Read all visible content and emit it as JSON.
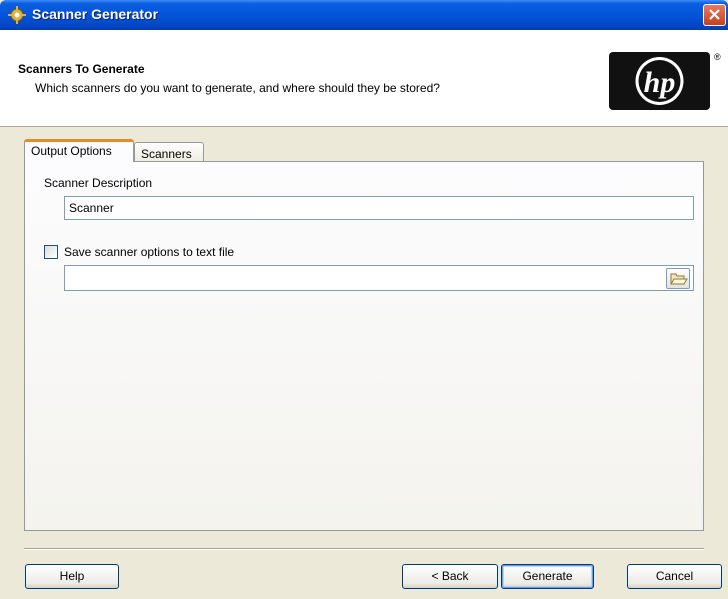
{
  "window": {
    "title": "Scanner Generator",
    "icon": "gear-wizard-icon"
  },
  "header": {
    "title": "Scanners To Generate",
    "subtitle": "Which scanners do you want to generate, and where should they be stored?",
    "logo": "hp",
    "logo_mark": "®"
  },
  "tabs": [
    {
      "label": "Output Options",
      "active": true
    },
    {
      "label": "Scanners",
      "active": false
    }
  ],
  "output_options": {
    "description_label": "Scanner Description",
    "description_value": "Scanner",
    "save_checkbox_label": "Save scanner options to text file",
    "save_checkbox_checked": false,
    "file_path_value": ""
  },
  "buttons": {
    "help": "Help",
    "back": "< Back",
    "generate": "Generate",
    "cancel": "Cancel"
  },
  "colors": {
    "title_bar": "#0454d8",
    "active_tab_highlight": "#e68b2c",
    "dialog_bg": "#ece9d8"
  }
}
